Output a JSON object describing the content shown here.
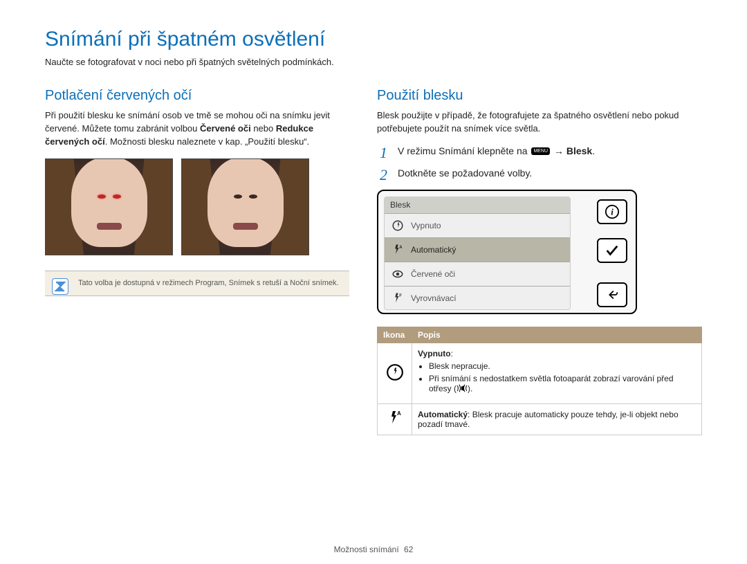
{
  "page": {
    "title": "Snímání při špatném osvětlení",
    "subtitle": "Naučte se fotografovat v noci nebo při špatných světelných podmínkách."
  },
  "left": {
    "heading": "Potlačení červených očí",
    "para_pre": "Při použití blesku ke snímání osob ve tmě se mohou oči na snímku jevit červené. Můžete tomu zabránit volbou ",
    "para_b1": "Červené oči",
    "para_mid": " nebo ",
    "para_b2": "Redukce červených očí",
    "para_post": ". Možnosti blesku naleznete v kap. „Použití blesku“.",
    "note": "Tato volba je dostupná v režimech Program, Snímek s retuší a Noční snímek."
  },
  "right": {
    "heading": "Použití blesku",
    "intro": "Blesk použijte v případě, že fotografujete za špatného osvětlení nebo pokud potřebujete použít na snímek více světla.",
    "step1_pre": "V režimu Snímání klepněte na ",
    "step1_after": " → ",
    "step1_bold": "Blesk",
    "step1_end": ".",
    "step2": "Dotkněte se požadované volby.",
    "menu_label": "MENU"
  },
  "screen": {
    "title": "Blesk",
    "opts": [
      "Vypnuto",
      "Automatický",
      "Červené oči",
      "Vyrovnávací"
    ],
    "selected_index": 1
  },
  "table": {
    "header_icon": "Ikona",
    "header_desc": "Popis",
    "row1": {
      "title": "Vypnuto",
      "title_suffix": ":",
      "b1": "Blesk nepracuje.",
      "b2_pre": "Při snímání s nedostatkem světla fotoaparát zobrazí varování před otřesy (",
      "b2_post": ")."
    },
    "row2": {
      "title": "Automatický",
      "rest": ": Blesk pracuje automaticky pouze tehdy, je-li objekt nebo pozadí tmavé."
    }
  },
  "footer": {
    "section": "Možnosti snímání",
    "page": "62"
  }
}
